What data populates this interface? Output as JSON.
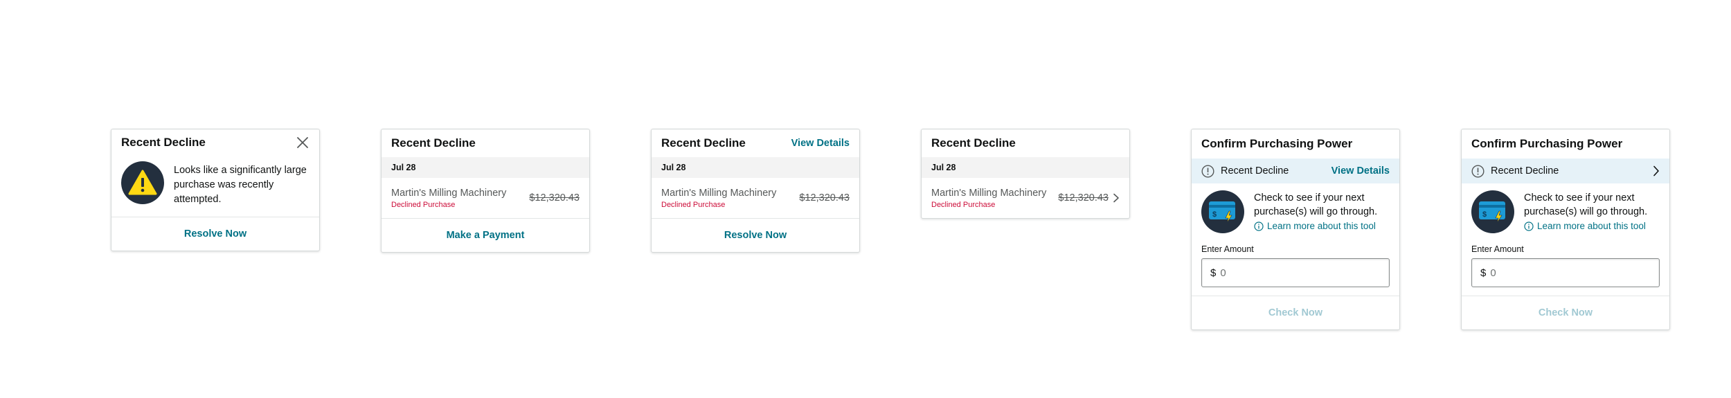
{
  "cards": [
    {
      "title": "Recent Decline",
      "message": "Looks like a significantly large purchase was recently attempted.",
      "action": "Resolve Now"
    },
    {
      "title": "Recent Decline",
      "date": "Jul 28",
      "merchant": "Martin's Milling Machinery",
      "status": "Declined Purchase",
      "amount": "$12,320.43",
      "action": "Make a Payment"
    },
    {
      "title": "Recent Decline",
      "header_link": "View Details",
      "date": "Jul 28",
      "merchant": "Martin's Milling Machinery",
      "status": "Declined Purchase",
      "amount": "$12,320.43",
      "action": "Resolve Now"
    },
    {
      "title": "Recent Decline",
      "date": "Jul 28",
      "merchant": "Martin's Milling Machinery",
      "status": "Declined Purchase",
      "amount": "$12,320.43"
    },
    {
      "title": "Confirm Purchasing Power",
      "banner_text": "Recent Decline",
      "banner_link": "View Details",
      "description": "Check to see if your next purchase(s) will go through.",
      "learn_more": "Learn more about this tool",
      "amount_label": "Enter Amount",
      "currency": "$",
      "amount_placeholder": "0",
      "action": "Check Now"
    },
    {
      "title": "Confirm Purchasing Power",
      "banner_text": "Recent Decline",
      "description": "Check to see if your next purchase(s) will go through.",
      "learn_more": "Learn more about this tool",
      "amount_label": "Enter Amount",
      "currency": "$",
      "amount_placeholder": "0",
      "action": "Check Now"
    }
  ],
  "icons": {
    "close": "close-icon",
    "warning": "warning-icon",
    "chevron": "chevron-right-icon",
    "info": "info-icon",
    "card": "credit-card-icon"
  },
  "colors": {
    "link": "#007185",
    "declined": "#cc0c39",
    "banner": "#e6f2f8",
    "icon_circle": "#232f3e",
    "warning": "#fed813",
    "card_blue": "#1d9bd6",
    "disabled_link": "#a2c9d3"
  }
}
